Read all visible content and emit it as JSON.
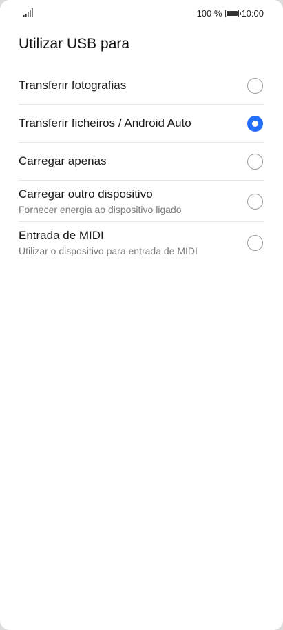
{
  "status_bar": {
    "battery_percent": "100 %",
    "time": "10:00",
    "signal_icon": "signal-bars-icon",
    "battery_icon": "battery-icon"
  },
  "page": {
    "title": "Utilizar USB para"
  },
  "options": [
    {
      "label": "Transferir fotografias",
      "sublabel": "",
      "selected": false
    },
    {
      "label": "Transferir ficheiros / Android Auto",
      "sublabel": "",
      "selected": true
    },
    {
      "label": "Carregar apenas",
      "sublabel": "",
      "selected": false
    },
    {
      "label": "Carregar outro dispositivo",
      "sublabel": "Fornecer energia ao dispositivo ligado",
      "selected": false
    },
    {
      "label": "Entrada de MIDI",
      "sublabel": "Utilizar o dispositivo para entrada de MIDI",
      "selected": false
    }
  ],
  "colors": {
    "accent": "#256fff",
    "background": "#ffffff",
    "text": "#1a1a1a",
    "subtext": "#7a7a7a"
  }
}
